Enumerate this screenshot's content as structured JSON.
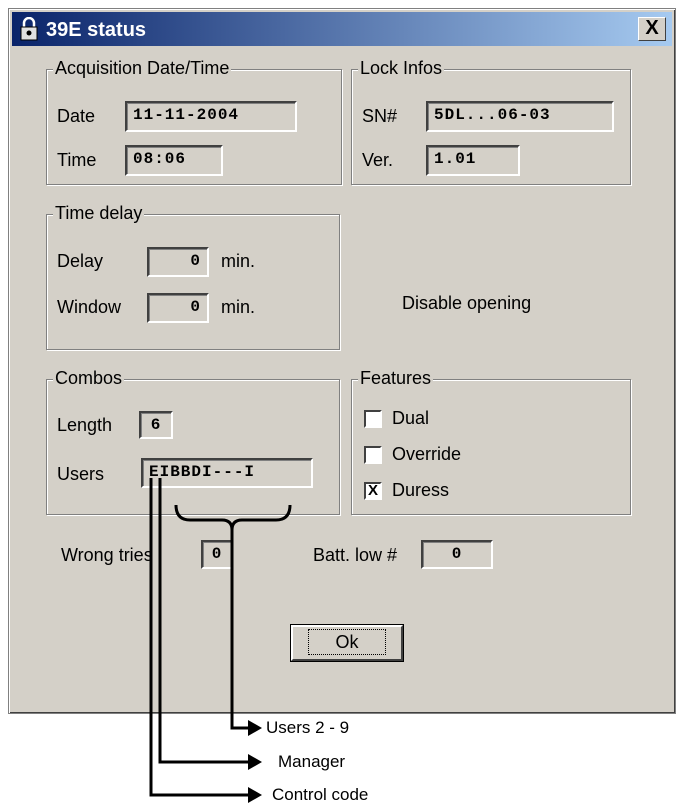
{
  "window": {
    "title": "39E status",
    "close_label": "X"
  },
  "acquisition": {
    "legend": "Acquisition Date/Time",
    "date_label": "Date",
    "date_value": "11-11-2004",
    "time_label": "Time",
    "time_value": "08:06"
  },
  "lock_infos": {
    "legend": "Lock Infos",
    "sn_label": "SN#",
    "sn_value": "5DL...06-03",
    "ver_label": "Ver.",
    "ver_value": "1.01"
  },
  "time_delay": {
    "legend": "Time delay",
    "delay_label": "Delay",
    "delay_value": "0",
    "delay_unit": "min.",
    "window_label": "Window",
    "window_value": "0",
    "window_unit": "min."
  },
  "status_text": "Disable opening",
  "combos": {
    "legend": "Combos",
    "length_label": "Length",
    "length_value": "6",
    "users_label": "Users",
    "users_value": "EIBBDI---I"
  },
  "features": {
    "legend": "Features",
    "items": [
      {
        "label": "Dual",
        "checked": false,
        "mark": ""
      },
      {
        "label": "Override",
        "checked": false,
        "mark": ""
      },
      {
        "label": "Duress",
        "checked": true,
        "mark": "X"
      }
    ]
  },
  "wrong_tries": {
    "label": "Wrong tries",
    "value": "0"
  },
  "batt_low": {
    "label": "Batt. low #",
    "value": "0"
  },
  "ok_button": {
    "label": "Ok"
  },
  "annotations": [
    "Users 2 - 9",
    "Manager",
    "Control code"
  ]
}
